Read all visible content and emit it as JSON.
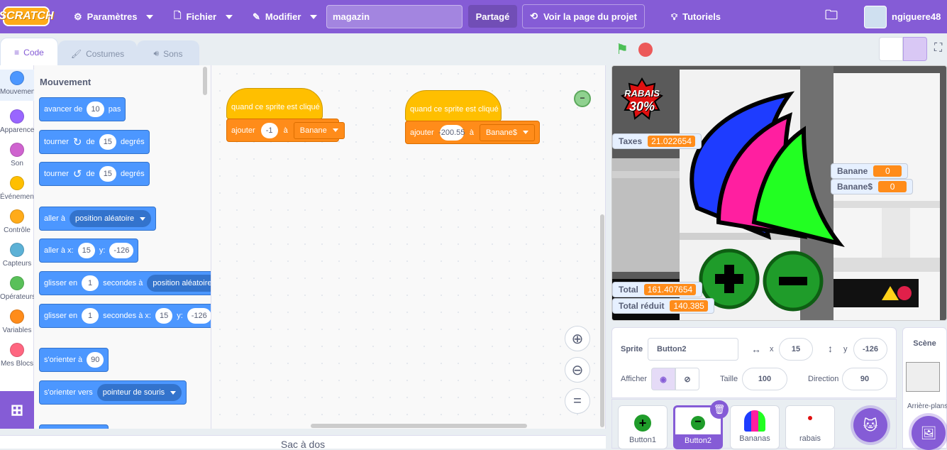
{
  "menubar": {
    "logo": "SCRATCH",
    "settings": "Paramètres",
    "file": "Fichier",
    "edit": "Modifier",
    "project_title": "magazin",
    "share": "Partagé",
    "see_page": "Voir la page du projet",
    "tutorials": "Tutoriels",
    "username": "ngiguere48"
  },
  "tabs": {
    "code": "Code",
    "costumes": "Costumes",
    "sounds": "Sons"
  },
  "categories": [
    {
      "label": "Mouvement",
      "color": "#4c97ff"
    },
    {
      "label": "Apparence",
      "color": "#9966ff"
    },
    {
      "label": "Son",
      "color": "#cf63cf"
    },
    {
      "label": "Événements",
      "color": "#ffbf00"
    },
    {
      "label": "Contrôle",
      "color": "#ffab19"
    },
    {
      "label": "Capteurs",
      "color": "#5cb1d6"
    },
    {
      "label": "Opérateurs",
      "color": "#59c059"
    },
    {
      "label": "Variables",
      "color": "#ff8c1a"
    },
    {
      "label": "Mes Blocs",
      "color": "#ff6680"
    }
  ],
  "palette": {
    "heading": "Mouvement",
    "move": {
      "a": "avancer de",
      "n": "10",
      "b": "pas"
    },
    "turn_right": {
      "a": "tourner",
      "b": "de",
      "n": "15",
      "c": "degrés"
    },
    "turn_left": {
      "a": "tourner",
      "b": "de",
      "n": "15",
      "c": "degrés"
    },
    "goto": {
      "a": "aller à",
      "dd": "position aléatoire"
    },
    "gotoxy": {
      "a": "aller à x:",
      "x": "15",
      "b": "y:",
      "y": "-126"
    },
    "glide": {
      "a": "glisser en",
      "n": "1",
      "b": "secondes à",
      "dd": "position aléatoire"
    },
    "glidexy": {
      "a": "glisser en",
      "n": "1",
      "b": "secondes à x:",
      "x": "15",
      "c": "y:",
      "y": "-126"
    },
    "point": {
      "a": "s'orienter à",
      "n": "90"
    },
    "pointto": {
      "a": "s'orienter vers",
      "dd": "pointeur de souris"
    }
  },
  "scripts": [
    {
      "hat": "quand ce sprite est cliqué",
      "a": "ajouter",
      "val": "-1",
      "b": "à",
      "var": "Banane"
    },
    {
      "hat": "quand ce sprite est cliqué",
      "a": "ajouter",
      "val": "-200.55",
      "b": "à",
      "var": "Banane$"
    }
  ],
  "backpack": "Sac à dos",
  "stage": {
    "monitors": [
      {
        "label": "Taxes",
        "value": "21.022654"
      },
      {
        "label": "Banane",
        "value": "0"
      },
      {
        "label": "Banane$",
        "value": "0"
      },
      {
        "label": "Total",
        "value": "161.407654"
      },
      {
        "label": "Total réduit",
        "value": "140.385"
      }
    ],
    "sign_line1": "RABAIS",
    "sign_line2": "30%"
  },
  "sprite_info": {
    "sprite_label": "Sprite",
    "sprite_name": "Button2",
    "x_label": "x",
    "x": "15",
    "y_label": "y",
    "y": "-126",
    "show_label": "Afficher",
    "size_label": "Taille",
    "size": "100",
    "direction_label": "Direction",
    "direction": "90"
  },
  "sprites": [
    {
      "name": "Button1"
    },
    {
      "name": "Button2"
    },
    {
      "name": "Bananas"
    },
    {
      "name": "rabais"
    }
  ],
  "stage_panel": {
    "title": "Scène",
    "backdrops": "Arrière-plans"
  },
  "colors": {
    "purple": "#855cd6",
    "motion": "#4c97ff",
    "events": "#ffbf00",
    "variables": "#ff8c1a"
  }
}
